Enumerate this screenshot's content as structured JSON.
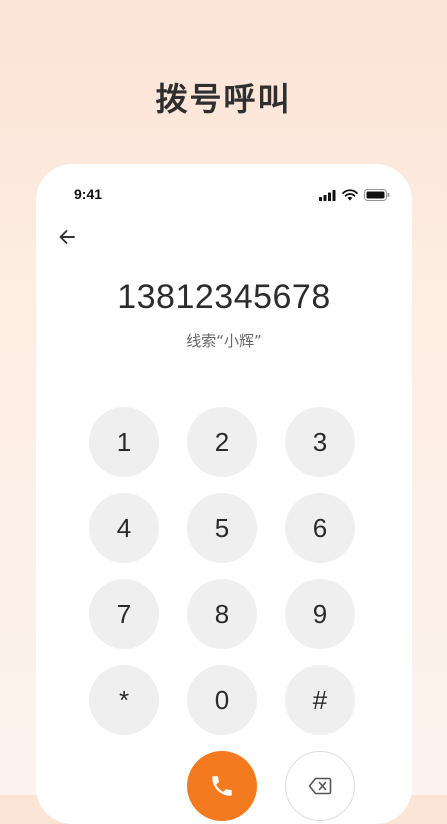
{
  "page": {
    "heading": "拨号呼叫"
  },
  "status_bar": {
    "time": "9:41",
    "icons": [
      "signal-icon",
      "wifi-icon",
      "battery-icon"
    ]
  },
  "dialer": {
    "back_icon": "back-arrow-icon",
    "number": "13812345678",
    "lead_label": "线索“小辉”",
    "keys": [
      "1",
      "2",
      "3",
      "4",
      "5",
      "6",
      "7",
      "8",
      "9",
      "*",
      "0",
      "#"
    ],
    "call_icon": "phone-icon",
    "delete_icon": "backspace-icon"
  },
  "colors": {
    "accent": "#f47a1f",
    "key_background": "#efefef",
    "background_top": "#fbe3d5",
    "background_bottom": "#fdf3ee"
  }
}
